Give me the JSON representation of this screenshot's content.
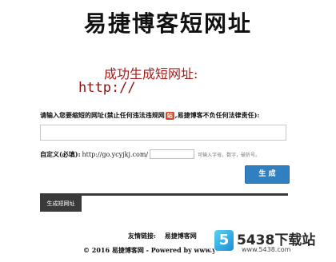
{
  "header": {
    "title": "易捷博客短网址"
  },
  "result": {
    "title": "成功生成短网址:",
    "url": "http://"
  },
  "form": {
    "prompt_before": "请输入您要缩短的网址(禁止任何违法违规网",
    "prompt_badge": "站",
    "prompt_after": ",易捷博客不负任何法律责任):",
    "url_value": "",
    "custom_label": "自定义(必填):",
    "custom_prefix": "http://go.ycyjkj.com/",
    "custom_value": "",
    "custom_hint": "可输入字母，数字，破折号。",
    "generate_label": "生 成"
  },
  "tabs": [
    {
      "label": "生成短网址"
    }
  ],
  "footer": {
    "friend_links_label": "友情链接:",
    "friend_link_1": "易捷博客网",
    "copyright": "© 2016 易捷博客网 - Powered by www.yc"
  },
  "watermark": {
    "logo_char": "5",
    "text": "5438下载站",
    "url": "www.5438.com"
  }
}
